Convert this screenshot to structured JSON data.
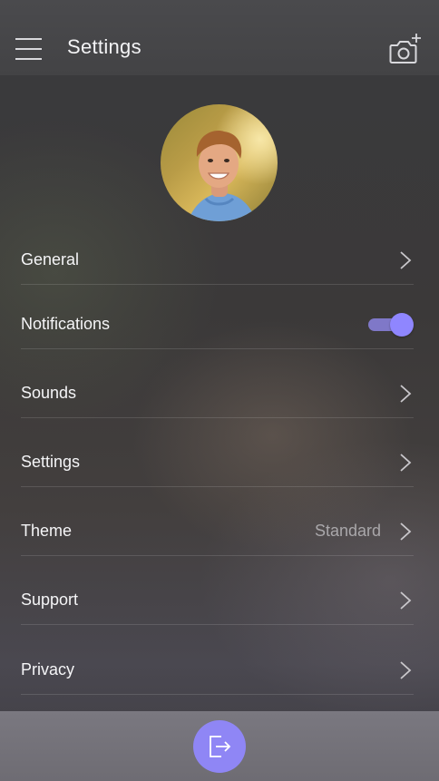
{
  "header": {
    "title": "Settings",
    "menu_icon": "hamburger-menu-icon",
    "camera_icon": "camera-add-icon"
  },
  "profile": {
    "avatar_icon": "user-avatar"
  },
  "settings": {
    "items": [
      {
        "label": "General",
        "control": "chevron"
      },
      {
        "label": "Notifications",
        "control": "toggle",
        "enabled": true
      },
      {
        "label": "Sounds",
        "control": "chevron"
      },
      {
        "label": "Settings",
        "control": "chevron"
      },
      {
        "label": "Theme",
        "value": "Standard",
        "control": "chevron"
      },
      {
        "label": "Support",
        "control": "chevron"
      },
      {
        "label": "Privacy",
        "control": "chevron"
      }
    ]
  },
  "footer": {
    "logout_icon": "logout-icon"
  },
  "colors": {
    "accent": "#8f86f5",
    "toggle_track": "#7f78c8",
    "header_bg": "#4a4a4d",
    "footer_bg": "#7a7880"
  }
}
